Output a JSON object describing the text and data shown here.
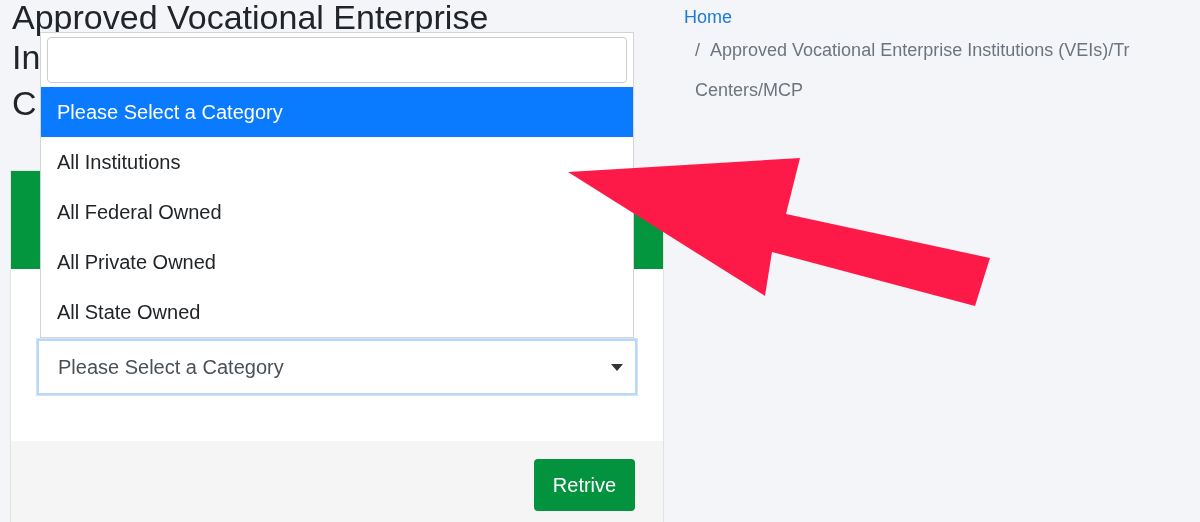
{
  "heading": {
    "lines": [
      "Approved Vocational Enterprise",
      "In",
      "C"
    ]
  },
  "breadcrumb": {
    "home": "Home",
    "separator": "/",
    "current_lines": [
      "Approved Vocational Enterprise Institutions (VEIs)/Tr",
      "Centers/MCP"
    ]
  },
  "card": {
    "select": {
      "value": "Please Select a Category"
    },
    "button": "Retrive"
  },
  "dropdown": {
    "options": [
      {
        "label": "Please Select a Category",
        "selected": true
      },
      {
        "label": "All Institutions",
        "selected": false
      },
      {
        "label": "All Federal Owned",
        "selected": false
      },
      {
        "label": "All Private Owned",
        "selected": false
      },
      {
        "label": "All State Owned",
        "selected": false
      }
    ]
  }
}
